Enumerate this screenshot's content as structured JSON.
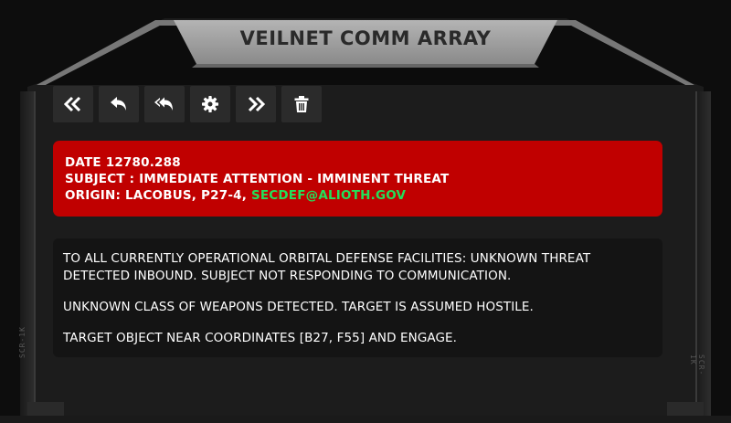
{
  "window": {
    "title": "VEILNET COMM ARRAY",
    "side_label_left": "SCR-1K",
    "side_label_right": "SCR-1K"
  },
  "toolbar": {
    "buttons": [
      {
        "icon": "double-chevron-left-icon",
        "label": "first"
      },
      {
        "icon": "reply-icon",
        "label": "reply"
      },
      {
        "icon": "reply-all-icon",
        "label": "reply all"
      },
      {
        "icon": "gear-icon",
        "label": "settings"
      },
      {
        "icon": "double-chevron-right-icon",
        "label": "next"
      },
      {
        "icon": "trash-icon",
        "label": "delete"
      }
    ]
  },
  "message": {
    "date": "DATE 12780.288",
    "subject": "SUBJECT : IMMEDIATE ATTENTION - IMMINENT THREAT",
    "origin_prefix": "ORIGIN: LACOBUS, P27-4, ",
    "origin_email": "SECDEF@ALIOTH.GOV",
    "body": [
      "TO ALL CURRENTLY OPERATIONAL ORBITAL DEFENSE FACILITIES: UNKNOWN THREAT DETECTED INBOUND. SUBJECT NOT RESPONDING TO COMMUNICATION.",
      "UNKNOWN CLASS OF WEAPONS DETECTED. TARGET IS ASSUMED HOSTILE.",
      "TARGET OBJECT NEAR COORDINATES [B27, F55] AND ENGAGE."
    ]
  },
  "colors": {
    "header_bg": "#c00000",
    "email": "#22e05a",
    "frame": "#9a9a9a"
  }
}
